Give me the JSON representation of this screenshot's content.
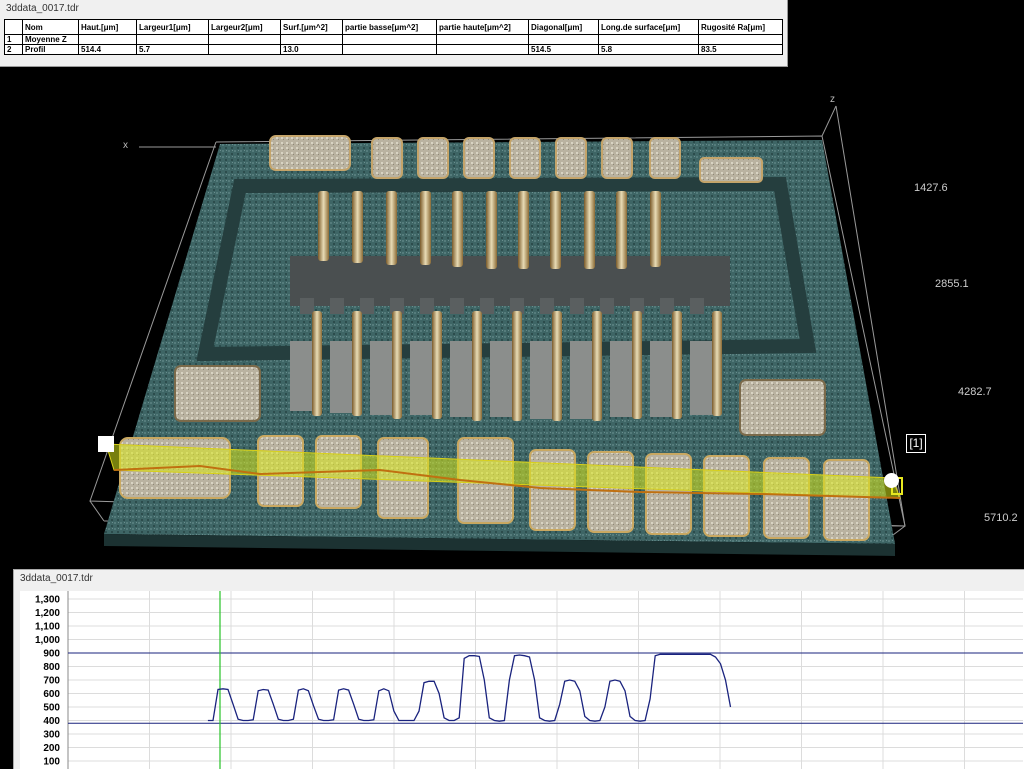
{
  "table_window": {
    "title": "3ddata_0017.tdr",
    "columns": [
      "",
      "Nom",
      "Haut.[μm]",
      "Largeur1[μm]",
      "Largeur2[μm]",
      "Surf.[μm^2]",
      "partie basse[μm^2]",
      "partie haute[μm^2]",
      "Diagonal[μm]",
      "Long.de surface[μm]",
      "Rugosité Ra[μm]"
    ],
    "rows": [
      [
        "1",
        "Moyenne Z",
        "",
        "",
        "",
        "",
        "",
        "",
        "",
        "",
        ""
      ],
      [
        "2",
        "Profil",
        "514.4",
        "5.7",
        "",
        "13.0",
        "",
        "",
        "514.5",
        "5.8",
        "83.5"
      ]
    ]
  },
  "view3d": {
    "axis_z_label": "z",
    "axis_x_label": "x",
    "depth_values": [
      "1427.6",
      "2855.1",
      "4282.7",
      "5710.2"
    ],
    "marker_label": "[1]"
  },
  "profile_window": {
    "title": "3ddata_0017.tdr"
  },
  "chart_data": {
    "type": "line",
    "ylim": [
      0,
      1300
    ],
    "y_ticks": [
      "1,300",
      "1,200",
      "1,100",
      "1,000",
      "900",
      "800",
      "700",
      "600",
      "500",
      "400",
      "300",
      "200",
      "100"
    ],
    "reference_lines": [
      900,
      380
    ],
    "cursor_x": 0.199,
    "x": [
      0.187,
      0.192,
      0.197,
      0.202,
      0.207,
      0.212,
      0.217,
      0.222,
      0.227,
      0.232,
      0.237,
      0.242,
      0.247,
      0.252,
      0.257,
      0.262,
      0.267,
      0.272,
      0.277,
      0.282,
      0.287,
      0.292,
      0.297,
      0.302,
      0.307,
      0.312,
      0.317,
      0.322,
      0.327,
      0.332,
      0.337,
      0.342,
      0.347,
      0.352,
      0.357,
      0.362,
      0.367,
      0.372,
      0.377,
      0.382,
      0.387,
      0.392,
      0.397,
      0.402,
      0.407,
      0.412,
      0.417,
      0.422,
      0.427,
      0.432,
      0.437,
      0.442,
      0.447,
      0.452,
      0.457,
      0.462,
      0.467,
      0.472,
      0.477,
      0.482,
      0.487,
      0.492,
      0.497,
      0.502,
      0.507,
      0.512,
      0.517,
      0.522,
      0.527,
      0.532,
      0.537,
      0.542,
      0.547,
      0.552,
      0.557,
      0.562,
      0.567,
      0.572,
      0.577,
      0.582,
      0.587,
      0.592,
      0.597,
      0.602,
      0.607,
      0.612,
      0.617,
      0.622,
      0.627,
      0.632,
      0.637,
      0.642,
      0.647,
      0.652,
      0.657,
      0.662,
      0.667,
      0.672,
      0.677,
      0.682,
      0.687,
      0.692,
      0.697,
      0.702,
      0.707,
      0.712,
      0.717,
      0.722,
      0.727,
      0.732,
      0.737,
      0.742,
      0.747,
      0.752,
      0.757,
      0.762,
      0.767,
      0.772,
      0.777,
      0.782,
      0.787,
      0.792,
      0.797,
      0.802,
      0.807,
      0.812,
      0.817,
      0.822,
      0.827,
      0.832,
      0.837,
      0.842,
      0.847,
      0.852,
      0.857,
      0.862
    ],
    "y": [
      400,
      400,
      630,
      635,
      630,
      520,
      410,
      400,
      400,
      405,
      620,
      630,
      625,
      520,
      410,
      400,
      400,
      410,
      625,
      635,
      620,
      510,
      410,
      400,
      400,
      405,
      625,
      635,
      625,
      520,
      410,
      400,
      400,
      405,
      620,
      635,
      620,
      470,
      400,
      400,
      400,
      400,
      470,
      680,
      690,
      690,
      600,
      420,
      400,
      400,
      420,
      860,
      880,
      880,
      875,
      700,
      420,
      400,
      395,
      400,
      700,
      880,
      885,
      880,
      870,
      700,
      420,
      400,
      395,
      400,
      520,
      690,
      700,
      690,
      620,
      430,
      400,
      395,
      400,
      500,
      690,
      700,
      690,
      620,
      430,
      400,
      395,
      400,
      560,
      880,
      890,
      890,
      890,
      890,
      890,
      890,
      890,
      890,
      890,
      890,
      890,
      870,
      820,
      700,
      500
    ]
  }
}
